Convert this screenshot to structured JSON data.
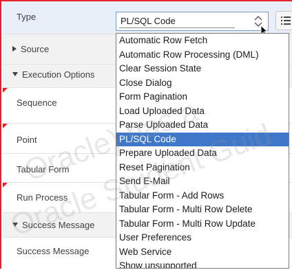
{
  "rows": [
    {
      "label": "Type"
    },
    {
      "label": "Source"
    },
    {
      "label": "Execution Options"
    },
    {
      "label": "Sequence"
    },
    {
      "label": "Point"
    },
    {
      "label": "Tabular Form"
    },
    {
      "label": "Run Process"
    },
    {
      "label": "Success Message"
    },
    {
      "label": "Success Message"
    }
  ],
  "type_select": {
    "value": "PL/SQL Code",
    "options": [
      "Automatic Row Fetch",
      "Automatic Row Processing (DML)",
      "Clear Session State",
      "Close Dialog",
      "Form Pagination",
      "Load Uploaded Data",
      "Parse Uploaded Data",
      "PL/SQL Code",
      "Prepare Uploaded Data",
      "Reset Pagination",
      "Send E-Mail",
      "Tabular Form - Add Rows",
      "Tabular Form - Multi Row Delete",
      "Tabular Form - Multi Row Update",
      "User Preferences",
      "Web Service",
      "Show unsupported"
    ],
    "selected_index": 7
  },
  "watermark": {
    "line1": "Oracle) has a",
    "line2": "Oracle Student Guid"
  },
  "colors": {
    "accent_red": "#e8202a",
    "selection_blue": "#3f78c9"
  }
}
